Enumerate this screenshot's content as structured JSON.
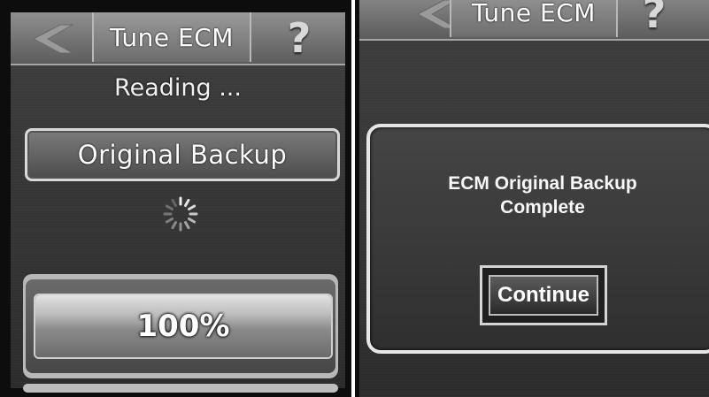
{
  "left_panel": {
    "header": {
      "title": "Tune ECM",
      "back_icon": "chevron-left-icon",
      "help_icon": "question-icon",
      "help_glyph": "?"
    },
    "status_text": "Reading ...",
    "action_button_label": "Original Backup",
    "spinner_icon": "loading-spinner-icon",
    "progress": {
      "label": "100%",
      "percent": 100
    }
  },
  "right_panel": {
    "header": {
      "title": "Tune ECM",
      "back_icon": "chevron-left-icon",
      "help_glyph": "?"
    },
    "dialog": {
      "message_line1": "ECM Original Backup",
      "message_line2": "Complete",
      "continue_label": "Continue"
    }
  },
  "colors": {
    "screen_bg": "#3a3a3a",
    "header_bg": "#7a7a7a",
    "text": "#ffffff"
  }
}
